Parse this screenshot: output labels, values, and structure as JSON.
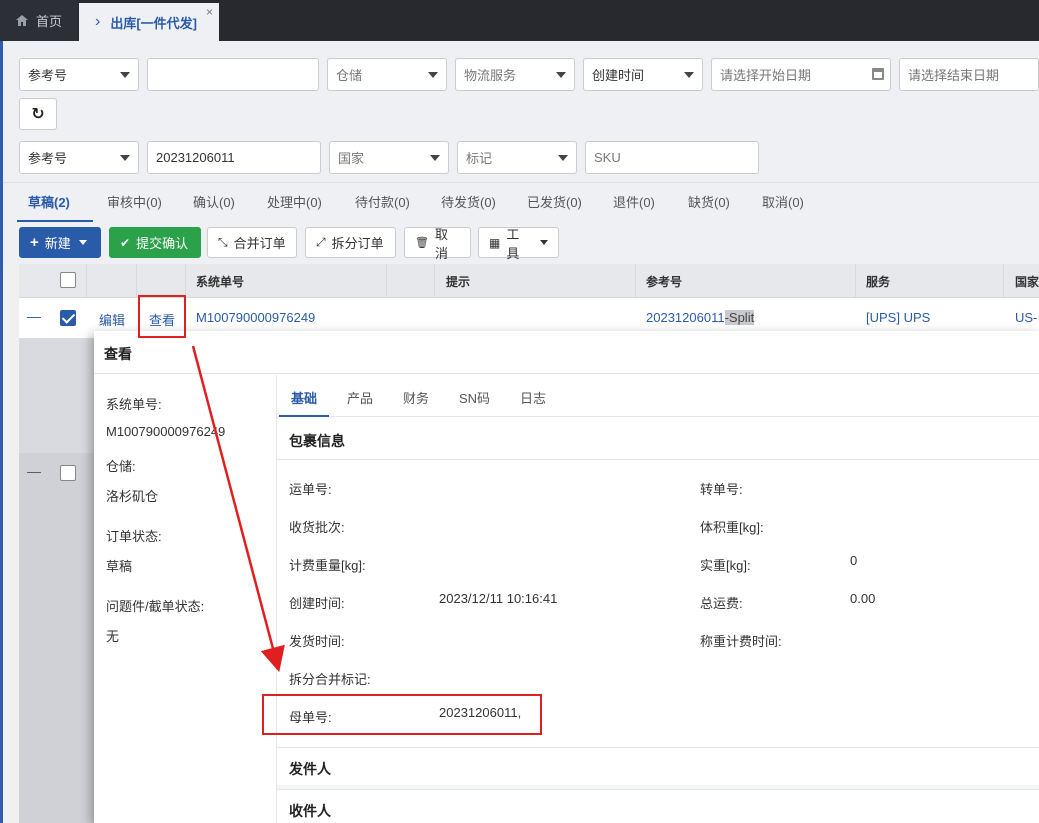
{
  "nav": {
    "home_label": "首页",
    "active_tab_label": "出库[一件代发]",
    "close_glyph": "×",
    "home_icon": "home-icon",
    "chevron_glyph": "›"
  },
  "filters": {
    "row1": {
      "ref_select": "参考号",
      "ref_input": "",
      "warehouse": "仓储",
      "logistics": "物流服务",
      "time_type": "创建时间",
      "start_date_placeholder": "请选择开始日期",
      "end_date_placeholder": "请选择结束日期"
    },
    "refresh_glyph": "↻",
    "row2": {
      "ref_select": "参考号",
      "ref_value": "20231206011",
      "country": "国家",
      "mark": "标记",
      "sku_placeholder": "SKU"
    }
  },
  "status_tabs": [
    {
      "label": "草稿(2)",
      "active": true
    },
    {
      "label": "审核中(0)"
    },
    {
      "label": "确认(0)"
    },
    {
      "label": "处理中(0)"
    },
    {
      "label": "待付款(0)"
    },
    {
      "label": "待发货(0)"
    },
    {
      "label": "已发货(0)"
    },
    {
      "label": "退件(0)"
    },
    {
      "label": "缺货(0)"
    },
    {
      "label": "取消(0)"
    }
  ],
  "actions": {
    "new": "新建",
    "submit": "提交确认",
    "merge": "合并订单",
    "split": "拆分订单",
    "cancel": "取消",
    "tools": "工具"
  },
  "table": {
    "headers": {
      "sys_no": "系统单号",
      "hint": "提示",
      "ref_no": "参考号",
      "service": "服务",
      "country": "国家"
    },
    "row1": {
      "dash": "—",
      "edit": "编辑",
      "view": "查看",
      "sys_no": "M100790000976249",
      "ref_no": "20231206011",
      "ref_suffix": "-Split",
      "service": "[UPS] UPS",
      "country": "US-"
    },
    "row2": {
      "dash": "—"
    }
  },
  "modal": {
    "title": "查看",
    "side": {
      "sys_no_label": "系统单号:",
      "sys_no_value": "M100790000976249",
      "warehouse_label": "仓储:",
      "warehouse_value": "洛杉矶仓",
      "status_label": "订单状态:",
      "status_value": "草稿",
      "issue_label": "问题件/截单状态:",
      "issue_value": "无"
    },
    "tabs": [
      "基础",
      "产品",
      "财务",
      "SN码",
      "日志"
    ],
    "package_title": "包裹信息",
    "fields": {
      "tracking_label": "运单号:",
      "transfer_label": "转单号:",
      "batch_label": "收货批次:",
      "volume_label": "体积重[kg]:",
      "charge_weight_label": "计费重量[kg]:",
      "actual_weight_label": "实重[kg]:",
      "actual_weight_value": "0",
      "created_label": "创建时间:",
      "created_value": "2023/12/11 10:16:41",
      "freight_label": "总运费:",
      "freight_value": "0.00",
      "ship_time_label": "发货时间:",
      "weigh_time_label": "称重计费时间:",
      "split_mark_label": "拆分合并标记:",
      "parent_label": "母单号:",
      "parent_value": "20231206011,"
    },
    "sender_title": "发件人",
    "receiver_title": "收件人"
  },
  "colors": {
    "accent": "#2a5ba8",
    "success": "#2ba14a",
    "annotation": "#e02020",
    "nav_bg": "#27292f"
  }
}
